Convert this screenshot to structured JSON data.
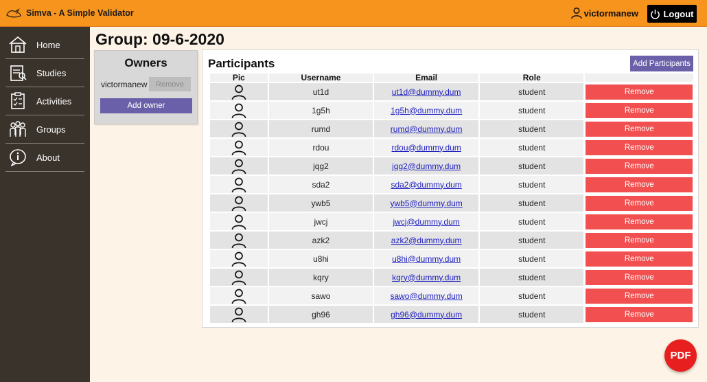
{
  "app": {
    "title": "Simva - A Simple Validator"
  },
  "header": {
    "username": "victormanew",
    "logout_label": "Logout"
  },
  "sidebar": {
    "items": [
      {
        "label": "Home",
        "icon": "home-icon"
      },
      {
        "label": "Studies",
        "icon": "studies-icon"
      },
      {
        "label": "Activities",
        "icon": "activities-icon"
      },
      {
        "label": "Groups",
        "icon": "groups-icon"
      },
      {
        "label": "About",
        "icon": "info-icon"
      }
    ]
  },
  "page": {
    "title": "Group: 09-6-2020"
  },
  "owners": {
    "title": "Owners",
    "owner_name": "victormanew",
    "remove_label": "Remove",
    "add_label": "Add owner"
  },
  "participants": {
    "title": "Participants",
    "add_label": "Add Participants",
    "columns": [
      "Pic",
      "Username",
      "Email",
      "Role",
      ""
    ],
    "remove_label": "Remove",
    "rows": [
      {
        "username": "ut1d",
        "email": "ut1d@dummy.dum",
        "role": "student"
      },
      {
        "username": "1g5h",
        "email": "1g5h@dummy.dum",
        "role": "student"
      },
      {
        "username": "rumd",
        "email": "rumd@dummy.dum",
        "role": "student"
      },
      {
        "username": "rdou",
        "email": "rdou@dummy.dum",
        "role": "student"
      },
      {
        "username": "jqg2",
        "email": "jqg2@dummy.dum",
        "role": "student"
      },
      {
        "username": "sda2",
        "email": "sda2@dummy.dum",
        "role": "student"
      },
      {
        "username": "ywb5",
        "email": "ywb5@dummy.dum",
        "role": "student"
      },
      {
        "username": "jwcj",
        "email": "jwcj@dummy.dum",
        "role": "student"
      },
      {
        "username": "azk2",
        "email": "azk2@dummy.dum",
        "role": "student"
      },
      {
        "username": "u8hi",
        "email": "u8hi@dummy.dum",
        "role": "student"
      },
      {
        "username": "kqry",
        "email": "kqry@dummy.dum",
        "role": "student"
      },
      {
        "username": "sawo",
        "email": "sawo@dummy.dum",
        "role": "student"
      },
      {
        "username": "gh96",
        "email": "gh96@dummy.dum",
        "role": "student"
      }
    ]
  },
  "pdf_button": {
    "label": "PDF"
  },
  "colors": {
    "topbar": "#f7941d",
    "sidebar": "#3a332c",
    "accent_purple": "#6a5fa9",
    "remove_red": "#f25050",
    "pdf_red": "#e81f1f"
  }
}
